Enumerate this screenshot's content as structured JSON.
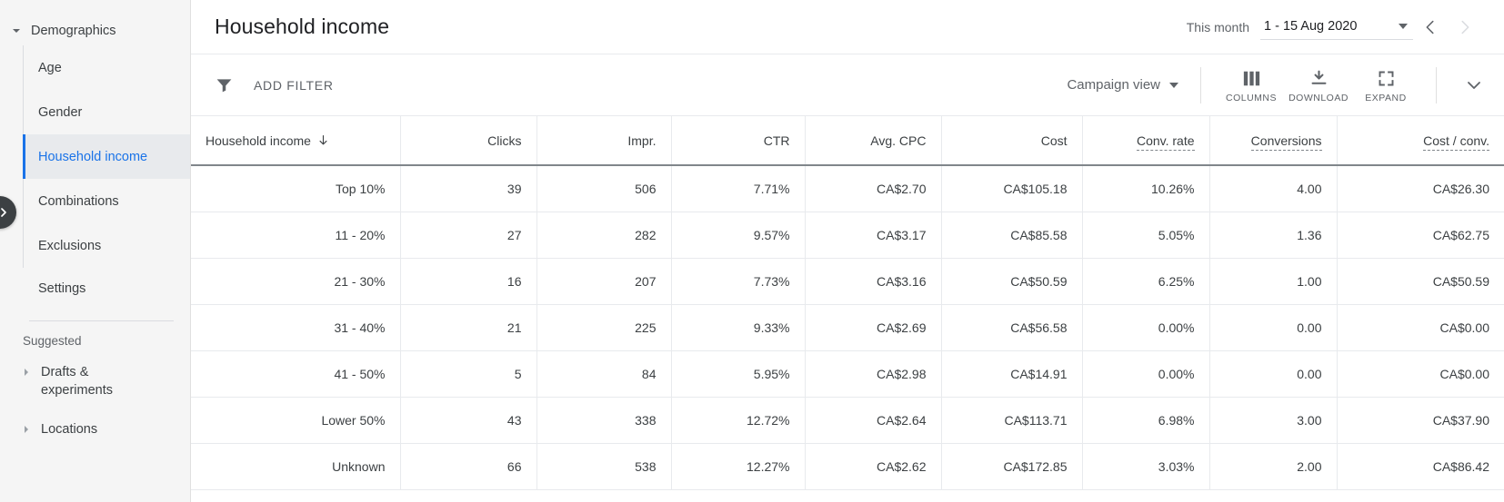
{
  "sidebar": {
    "group": {
      "label": "Demographics",
      "icon": "chevron-down-icon"
    },
    "items": [
      {
        "label": "Age",
        "active": false
      },
      {
        "label": "Gender",
        "active": false
      },
      {
        "label": "Household income",
        "active": true
      },
      {
        "label": "Combinations",
        "active": false
      },
      {
        "label": "Exclusions",
        "active": false
      },
      {
        "label": "Settings",
        "active": false
      }
    ],
    "section_label": "Suggested",
    "leaves": [
      {
        "label": "Drafts & experiments"
      },
      {
        "label": "Locations"
      }
    ],
    "collapse_icon": "chevron-right-icon"
  },
  "header": {
    "title": "Household income",
    "date_preset": "This month",
    "date_range": "1 - 15 Aug 2020",
    "prev_icon": "chevron-left-icon",
    "next_icon": "chevron-right-icon"
  },
  "toolbar": {
    "filter_icon": "funnel-icon",
    "add_filter_label": "ADD FILTER",
    "view_label": "Campaign view",
    "buttons": [
      {
        "label": "COLUMNS",
        "icon": "columns-icon"
      },
      {
        "label": "DOWNLOAD",
        "icon": "download-icon"
      },
      {
        "label": "EXPAND",
        "icon": "expand-icon"
      }
    ],
    "collapse_panel_icon": "chevron-down-icon"
  },
  "table": {
    "columns": [
      {
        "label": "Household income",
        "align": "left",
        "sorted": true,
        "sort_icon": "arrow-down-icon",
        "tooltip": false
      },
      {
        "label": "Clicks",
        "align": "right",
        "sorted": false,
        "tooltip": false
      },
      {
        "label": "Impr.",
        "align": "right",
        "sorted": false,
        "tooltip": false
      },
      {
        "label": "CTR",
        "align": "right",
        "sorted": false,
        "tooltip": false
      },
      {
        "label": "Avg. CPC",
        "align": "right",
        "sorted": false,
        "tooltip": false
      },
      {
        "label": "Cost",
        "align": "right",
        "sorted": false,
        "tooltip": false
      },
      {
        "label": "Conv. rate",
        "align": "right",
        "sorted": false,
        "tooltip": true
      },
      {
        "label": "Conversions",
        "align": "right",
        "sorted": false,
        "tooltip": true
      },
      {
        "label": "Cost / conv.",
        "align": "right",
        "sorted": false,
        "tooltip": true
      }
    ],
    "rows": [
      [
        "Top 10%",
        "39",
        "506",
        "7.71%",
        "CA$2.70",
        "CA$105.18",
        "10.26%",
        "4.00",
        "CA$26.30"
      ],
      [
        "11 - 20%",
        "27",
        "282",
        "9.57%",
        "CA$3.17",
        "CA$85.58",
        "5.05%",
        "1.36",
        "CA$62.75"
      ],
      [
        "21 - 30%",
        "16",
        "207",
        "7.73%",
        "CA$3.16",
        "CA$50.59",
        "6.25%",
        "1.00",
        "CA$50.59"
      ],
      [
        "31 - 40%",
        "21",
        "225",
        "9.33%",
        "CA$2.69",
        "CA$56.58",
        "0.00%",
        "0.00",
        "CA$0.00"
      ],
      [
        "41 - 50%",
        "5",
        "84",
        "5.95%",
        "CA$2.98",
        "CA$14.91",
        "0.00%",
        "0.00",
        "CA$0.00"
      ],
      [
        "Lower 50%",
        "43",
        "338",
        "12.72%",
        "CA$2.64",
        "CA$113.71",
        "6.98%",
        "3.00",
        "CA$37.90"
      ],
      [
        "Unknown",
        "66",
        "538",
        "12.27%",
        "CA$2.62",
        "CA$172.85",
        "3.03%",
        "2.00",
        "CA$86.42"
      ]
    ]
  },
  "colors": {
    "accent": "#1a73e8",
    "text_primary": "#202124",
    "text_secondary": "#5f6368",
    "sidebar_bg": "#f5f5f5",
    "active_bg": "#e8eaed",
    "border": "#e8eaed"
  }
}
